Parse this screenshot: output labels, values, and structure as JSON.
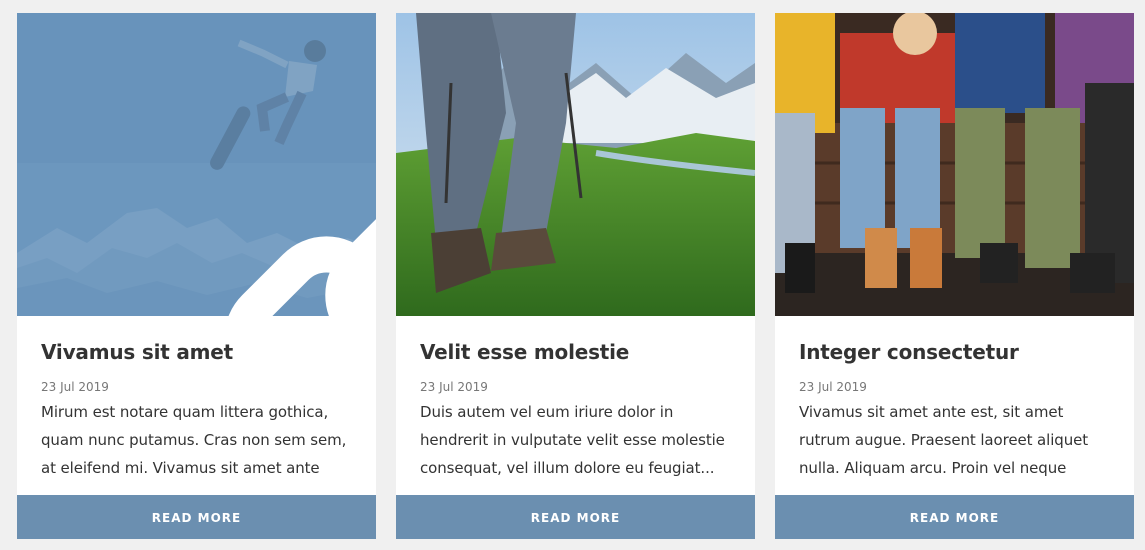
{
  "cards": [
    {
      "title": "Vivamus sit amet",
      "date": "23 Jul 2019",
      "excerpt": "Mirum est notare quam littera gothica, quam nunc putamus. Cras non sem sem, at eleifend mi. Vivamus sit amet ante est,...",
      "button": "READ MORE",
      "image": "snowboarder-mountains-photo",
      "overlay_icon": "link-icon"
    },
    {
      "title": "Velit esse molestie",
      "date": "23 Jul 2019",
      "excerpt": "Duis autem vel eum iriure dolor in hendrerit in vulputate velit esse molestie consequat, vel illum dolore eu feugiat...",
      "button": "READ MORE",
      "image": "hiker-mountain-valley-photo"
    },
    {
      "title": "Integer consectetur",
      "date": "23 Jul 2019",
      "excerpt": "Vivamus sit amet ante est, sit amet rutrum augue. Praesent laoreet aliquet nulla. Aliquam arcu. Proin vel neque non...",
      "button": "READ MORE",
      "image": "group-sitting-bench-photo"
    }
  ],
  "colors": {
    "button_bg": "#6b8fb0",
    "overlay": "#638fb8",
    "page_bg": "#f0f0f0"
  }
}
